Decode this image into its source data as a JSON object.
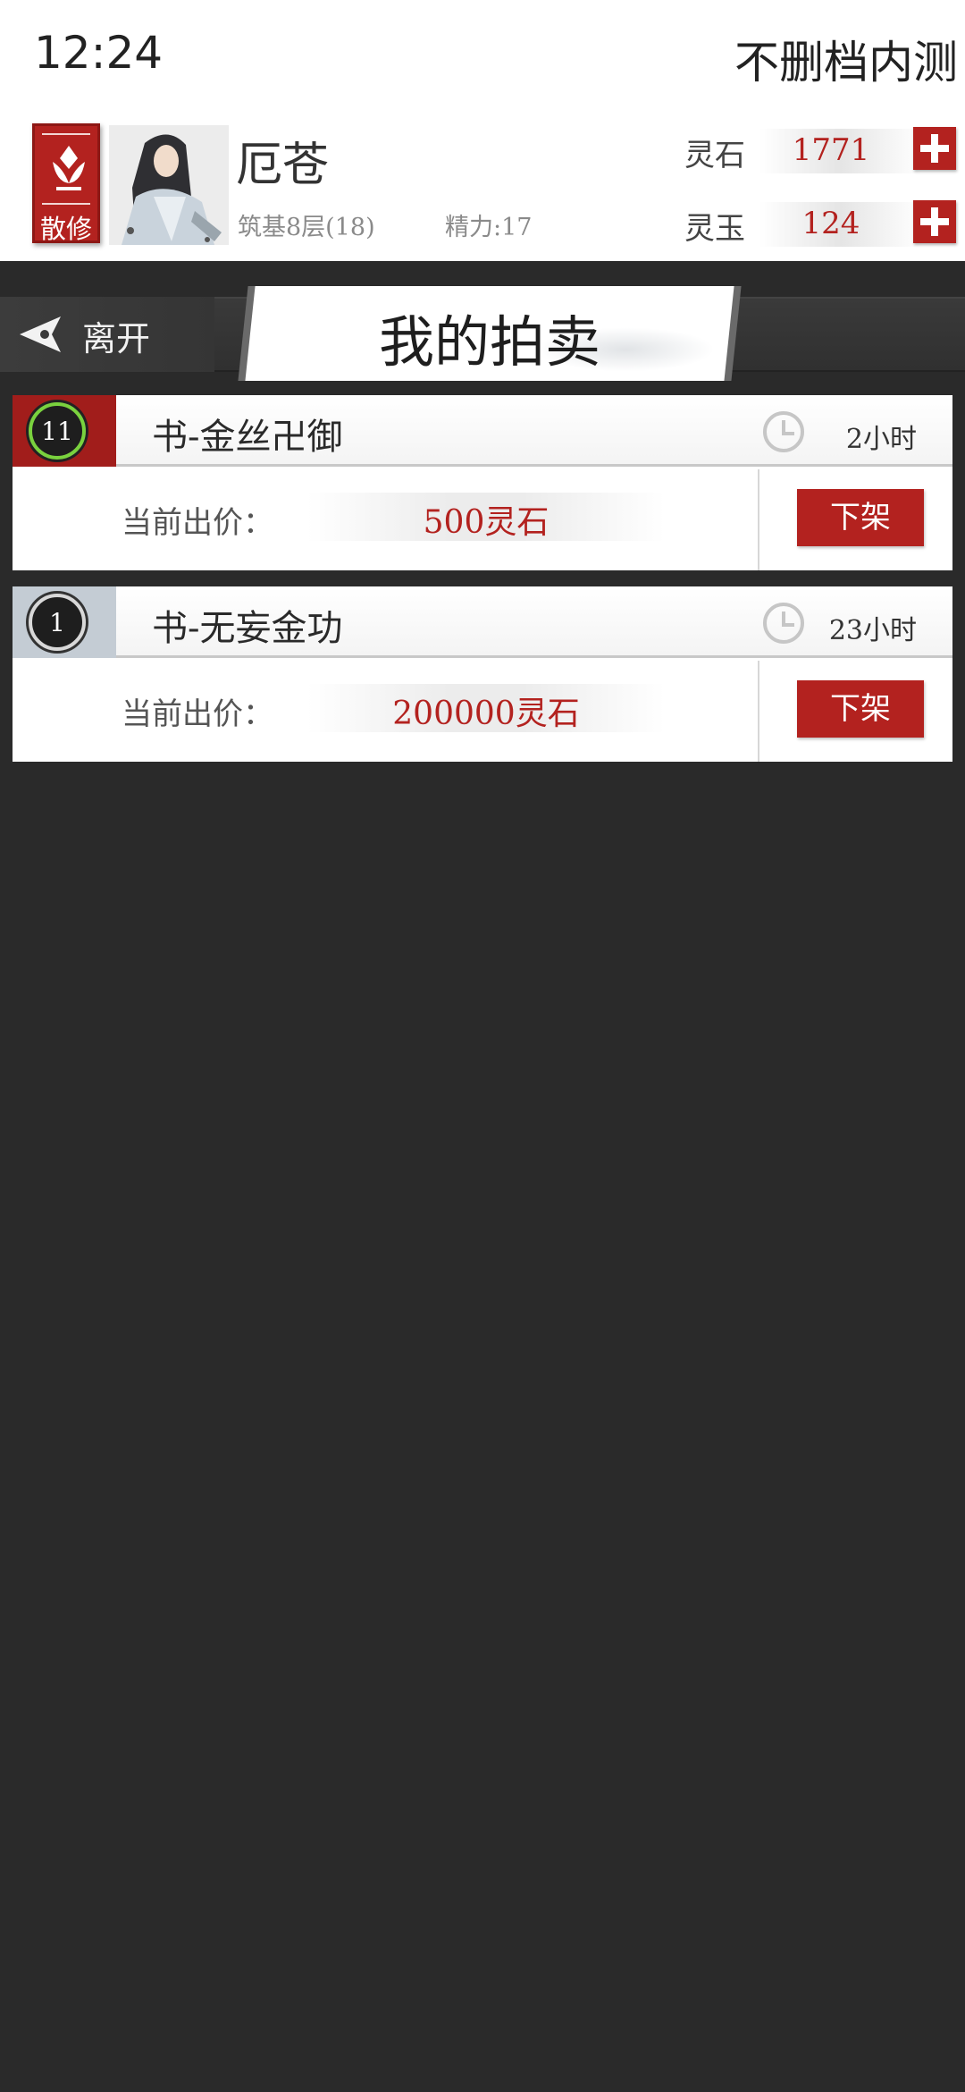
{
  "status_bar": {
    "time": "12:24",
    "right_text": "不删档内测"
  },
  "player": {
    "sect_label": "散修",
    "name": "厄苍",
    "realm": "筑基8层(18)",
    "energy": "精力:17",
    "resources": [
      {
        "label": "灵石",
        "value": "1771",
        "icon": "plus-icon"
      },
      {
        "label": "灵玉",
        "value": "124",
        "icon": "plus-icon"
      }
    ]
  },
  "nav": {
    "back_label": "离开",
    "title": "我的拍卖"
  },
  "listings": [
    {
      "rank": "11",
      "rank_style": "green",
      "item_name": "书-金丝卍御",
      "time_left": "2小时",
      "price_label": "当前出价：",
      "price": "500灵石",
      "action": "下架"
    },
    {
      "rank": "1",
      "rank_style": "black",
      "item_name": "书-无妄金功",
      "time_left": "23小时",
      "price_label": "当前出价：",
      "price": "200000灵石",
      "action": "下架"
    }
  ],
  "colors": {
    "accent_red": "#b3221f",
    "background": "#2a2a2a",
    "card": "#ffffff",
    "rank_ring_green": "#7ad23e"
  }
}
